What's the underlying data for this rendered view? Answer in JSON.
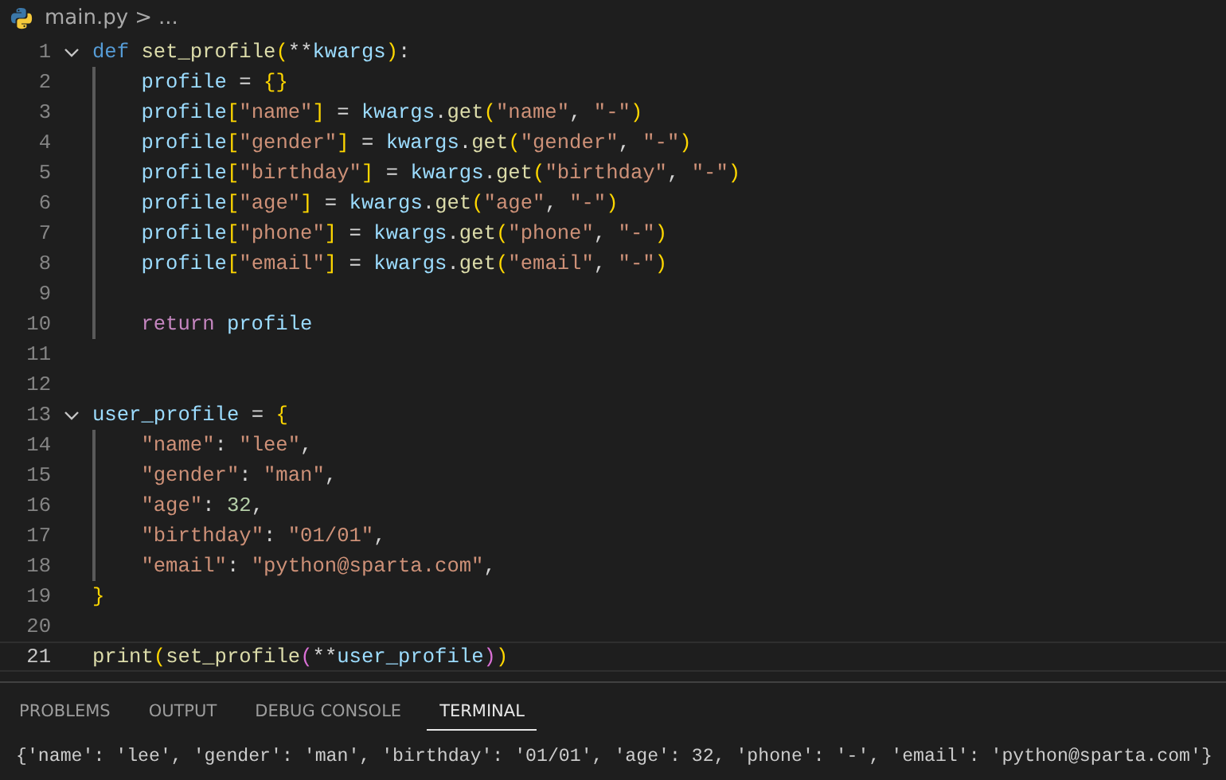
{
  "breadcrumb": {
    "file": "main.py",
    "separator": ">",
    "more": "..."
  },
  "lines": [
    {
      "number": "1",
      "current": false,
      "indented": false,
      "fold": {
        "expanded": true
      },
      "tokens": [
        {
          "kind": "keyword",
          "text": "def"
        },
        {
          "kind": "function",
          "text": "set_profile"
        },
        {
          "kind": "bracket1",
          "text": "("
        },
        {
          "kind": "operator",
          "text": "**"
        },
        {
          "kind": "variable",
          "text": "kwargs"
        },
        {
          "kind": "bracket1",
          "text": ")"
        },
        {
          "kind": "operator",
          "text": ":"
        }
      ]
    },
    {
      "number": "2",
      "current": false,
      "indented": true,
      "tokens": [
        {
          "kind": "variable",
          "text": "profile"
        },
        {
          "kind": "operator",
          "text": " = "
        },
        {
          "kind": "bracket1",
          "text": "{}"
        }
      ]
    },
    {
      "number": "3",
      "current": false,
      "indented": true,
      "tokens": [
        {
          "kind": "variable",
          "text": "profile"
        },
        {
          "kind": "bracket1",
          "text": "["
        },
        {
          "kind": "string",
          "text": "\"name\""
        },
        {
          "kind": "bracket1",
          "text": "]"
        },
        {
          "kind": "operator",
          "text": " = "
        },
        {
          "kind": "variable",
          "text": "kwargs"
        },
        {
          "kind": "operator",
          "text": "."
        },
        {
          "kind": "function",
          "text": "get"
        },
        {
          "kind": "bracket1",
          "text": "("
        },
        {
          "kind": "string",
          "text": "\"name\""
        },
        {
          "kind": "operator",
          "text": ", "
        },
        {
          "kind": "string",
          "text": "\"-\""
        },
        {
          "kind": "bracket1",
          "text": ")"
        }
      ]
    },
    {
      "number": "4",
      "current": false,
      "indented": true,
      "tokens": [
        {
          "kind": "variable",
          "text": "profile"
        },
        {
          "kind": "bracket1",
          "text": "["
        },
        {
          "kind": "string",
          "text": "\"gender\""
        },
        {
          "kind": "bracket1",
          "text": "]"
        },
        {
          "kind": "operator",
          "text": " = "
        },
        {
          "kind": "variable",
          "text": "kwargs"
        },
        {
          "kind": "operator",
          "text": "."
        },
        {
          "kind": "function",
          "text": "get"
        },
        {
          "kind": "bracket1",
          "text": "("
        },
        {
          "kind": "string",
          "text": "\"gender\""
        },
        {
          "kind": "operator",
          "text": ", "
        },
        {
          "kind": "string",
          "text": "\"-\""
        },
        {
          "kind": "bracket1",
          "text": ")"
        }
      ]
    },
    {
      "number": "5",
      "current": false,
      "indented": true,
      "tokens": [
        {
          "kind": "variable",
          "text": "profile"
        },
        {
          "kind": "bracket1",
          "text": "["
        },
        {
          "kind": "string",
          "text": "\"birthday\""
        },
        {
          "kind": "bracket1",
          "text": "]"
        },
        {
          "kind": "operator",
          "text": " = "
        },
        {
          "kind": "variable",
          "text": "kwargs"
        },
        {
          "kind": "operator",
          "text": "."
        },
        {
          "kind": "function",
          "text": "get"
        },
        {
          "kind": "bracket1",
          "text": "("
        },
        {
          "kind": "string",
          "text": "\"birthday\""
        },
        {
          "kind": "operator",
          "text": ", "
        },
        {
          "kind": "string",
          "text": "\"-\""
        },
        {
          "kind": "bracket1",
          "text": ")"
        }
      ]
    },
    {
      "number": "6",
      "current": false,
      "indented": true,
      "tokens": [
        {
          "kind": "variable",
          "text": "profile"
        },
        {
          "kind": "bracket1",
          "text": "["
        },
        {
          "kind": "string",
          "text": "\"age\""
        },
        {
          "kind": "bracket1",
          "text": "]"
        },
        {
          "kind": "operator",
          "text": " = "
        },
        {
          "kind": "variable",
          "text": "kwargs"
        },
        {
          "kind": "operator",
          "text": "."
        },
        {
          "kind": "function",
          "text": "get"
        },
        {
          "kind": "bracket1",
          "text": "("
        },
        {
          "kind": "string",
          "text": "\"age\""
        },
        {
          "kind": "operator",
          "text": ", "
        },
        {
          "kind": "string",
          "text": "\"-\""
        },
        {
          "kind": "bracket1",
          "text": ")"
        }
      ]
    },
    {
      "number": "7",
      "current": false,
      "indented": true,
      "tokens": [
        {
          "kind": "variable",
          "text": "profile"
        },
        {
          "kind": "bracket1",
          "text": "["
        },
        {
          "kind": "string",
          "text": "\"phone\""
        },
        {
          "kind": "bracket1",
          "text": "]"
        },
        {
          "kind": "operator",
          "text": " = "
        },
        {
          "kind": "variable",
          "text": "kwargs"
        },
        {
          "kind": "operator",
          "text": "."
        },
        {
          "kind": "function",
          "text": "get"
        },
        {
          "kind": "bracket1",
          "text": "("
        },
        {
          "kind": "string",
          "text": "\"phone\""
        },
        {
          "kind": "operator",
          "text": ", "
        },
        {
          "kind": "string",
          "text": "\"-\""
        },
        {
          "kind": "bracket1",
          "text": ")"
        }
      ]
    },
    {
      "number": "8",
      "current": false,
      "indented": true,
      "tokens": [
        {
          "kind": "variable",
          "text": "profile"
        },
        {
          "kind": "bracket1",
          "text": "["
        },
        {
          "kind": "string",
          "text": "\"email\""
        },
        {
          "kind": "bracket1",
          "text": "]"
        },
        {
          "kind": "operator",
          "text": " = "
        },
        {
          "kind": "variable",
          "text": "kwargs"
        },
        {
          "kind": "operator",
          "text": "."
        },
        {
          "kind": "function",
          "text": "get"
        },
        {
          "kind": "bracket1",
          "text": "("
        },
        {
          "kind": "string",
          "text": "\"email\""
        },
        {
          "kind": "operator",
          "text": ", "
        },
        {
          "kind": "string",
          "text": "\"-\""
        },
        {
          "kind": "bracket1",
          "text": ")"
        }
      ]
    },
    {
      "number": "9",
      "current": false
    },
    {
      "number": "10",
      "current": false,
      "indented": true,
      "tokens": [
        {
          "kind": "control",
          "text": "return"
        },
        {
          "kind": "variable",
          "text": "profile"
        }
      ]
    },
    {
      "number": "11",
      "current": false,
      "indented": false
    },
    {
      "number": "12",
      "current": false,
      "indented": false
    },
    {
      "number": "13",
      "current": false,
      "indented": false,
      "fold": {
        "expanded": true
      },
      "tokens": [
        {
          "kind": "variable",
          "text": "user_profile"
        },
        {
          "kind": "operator",
          "text": " = "
        },
        {
          "kind": "bracket1",
          "text": "{"
        }
      ]
    },
    {
      "number": "14",
      "current": false,
      "indented": true,
      "tokens": [
        {
          "kind": "string",
          "text": "\"name\""
        },
        {
          "kind": "operator",
          "text": ": "
        },
        {
          "kind": "string",
          "text": "\"lee\""
        },
        {
          "kind": "operator",
          "text": ","
        }
      ]
    },
    {
      "number": "15",
      "current": false,
      "indented": true,
      "tokens": [
        {
          "kind": "string",
          "text": "\"gender\""
        },
        {
          "kind": "operator",
          "text": ": "
        },
        {
          "kind": "string",
          "text": "\"man\""
        },
        {
          "kind": "operator",
          "text": ","
        }
      ]
    },
    {
      "number": "16",
      "current": false,
      "indented": true,
      "tokens": [
        {
          "kind": "string",
          "text": "\"age\""
        },
        {
          "kind": "operator",
          "text": ": "
        },
        {
          "kind": "number",
          "text": "32"
        },
        {
          "kind": "operator",
          "text": ","
        }
      ]
    },
    {
      "number": "17",
      "current": false,
      "indented": true,
      "tokens": [
        {
          "kind": "string",
          "text": "\"birthday\""
        },
        {
          "kind": "operator",
          "text": ": "
        },
        {
          "kind": "string",
          "text": "\"01/01\""
        },
        {
          "kind": "operator",
          "text": ","
        }
      ]
    },
    {
      "number": "18",
      "current": false,
      "indented": true,
      "tokens": [
        {
          "kind": "string",
          "text": "\"email\""
        },
        {
          "kind": "operator",
          "text": ": "
        },
        {
          "kind": "string",
          "text": "\"python@sparta.com\""
        },
        {
          "kind": "operator",
          "text": ","
        }
      ]
    },
    {
      "number": "19",
      "current": false,
      "indented": false,
      "tokens": [
        {
          "kind": "bracket1",
          "text": "}"
        }
      ]
    },
    {
      "number": "20",
      "current": false,
      "indented": false
    },
    {
      "number": "21",
      "current": true,
      "indented": false,
      "tokens": [
        {
          "kind": "function",
          "text": "print"
        },
        {
          "kind": "bracket1",
          "text": "("
        },
        {
          "kind": "function",
          "text": "set_profile"
        },
        {
          "kind": "bracket2",
          "text": "("
        },
        {
          "kind": "operator",
          "text": "**"
        },
        {
          "kind": "variable",
          "text": "user_profile"
        },
        {
          "kind": "bracket2",
          "text": ")"
        },
        {
          "kind": "bracket1",
          "text": ")"
        }
      ]
    }
  ],
  "panel": {
    "tabs": [
      {
        "label": "PROBLEMS",
        "selected": false
      },
      {
        "label": "OUTPUT",
        "selected": false
      },
      {
        "label": "DEBUG CONSOLE",
        "selected": false
      },
      {
        "label": "TERMINAL",
        "selected": true
      }
    ],
    "terminal_output": "{'name': 'lee', 'gender': 'man', 'birthday': '01/01', 'age': 32, 'phone': '-', 'email': 'python@sparta.com'}"
  }
}
